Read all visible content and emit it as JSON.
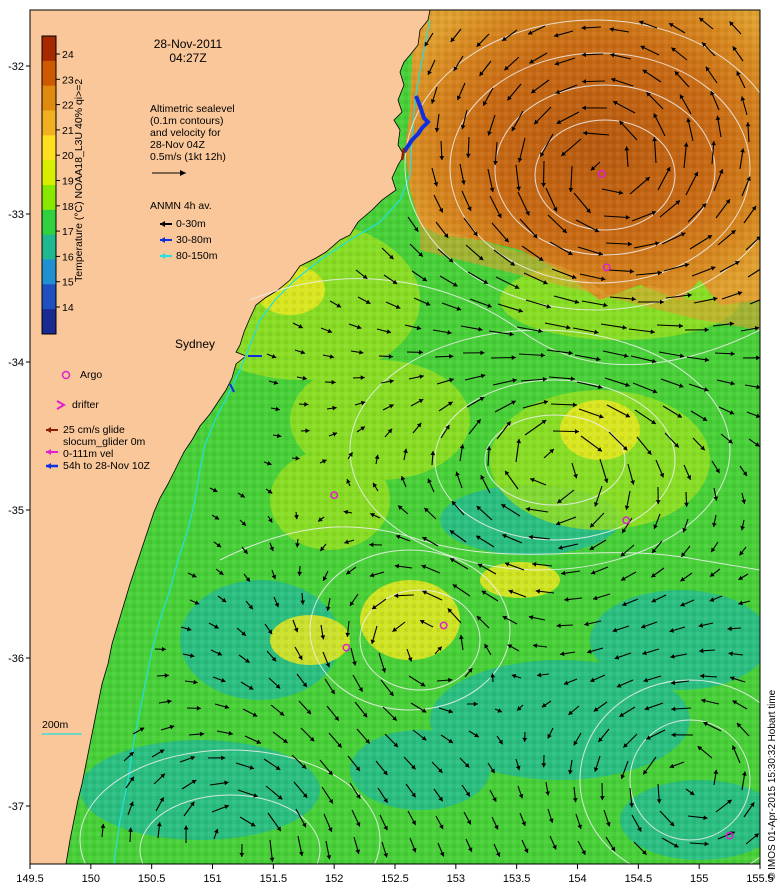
{
  "header": {
    "date": "28-Nov-2011",
    "time": "04:27Z"
  },
  "colorbar": {
    "label": "Temperature (°C) NOAA18_L3U 40% qi>=2",
    "ticks": [
      "24",
      "23",
      "22",
      "21",
      "20",
      "19",
      "18",
      "17",
      "16",
      "15",
      "14"
    ],
    "colors": [
      "#a52a00",
      "#cd5a00",
      "#e08a10",
      "#f0b020",
      "#ffe020",
      "#d8f000",
      "#88e800",
      "#30d040",
      "#20b890",
      "#2090d0",
      "#2050c0",
      "#1a2a90"
    ]
  },
  "sealevel_note": {
    "lines": [
      "Altimetric sealevel",
      "(0.1m contours)",
      "and velocity for",
      "28-Nov 04Z",
      "0.5m/s (1kt 12h)"
    ]
  },
  "anmn": {
    "title": "ANMN 4h av.",
    "items": [
      {
        "label": "0-30m",
        "color": "#000000"
      },
      {
        "label": "30-80m",
        "color": "#1030e0"
      },
      {
        "label": "80-150m",
        "color": "#20e0e0"
      }
    ]
  },
  "legend": {
    "argo": "Argo",
    "drifter": "drifter",
    "glider_lines": [
      "25 cm/s glide",
      "slocum_glider 0m",
      "0-111m vel",
      "54h to 28-Nov 10Z"
    ]
  },
  "place": {
    "sydney": "Sydney"
  },
  "isobath_label": "200m",
  "y_axis": {
    "ticks": [
      "-32",
      "-33",
      "-34",
      "-35",
      "-36",
      "-37"
    ]
  },
  "x_axis": {
    "ticks": [
      "149.5",
      "150",
      "150.5",
      "151",
      "151.5",
      "152",
      "152.5",
      "153",
      "153.5",
      "154",
      "154.5",
      "155",
      "155.5"
    ]
  },
  "credit": "© IMOS 01-Apr-2015 15:30:32 Hobart time",
  "argo_floats": [
    {
      "lon": 154.2,
      "lat": -32.73
    },
    {
      "lon": 154.24,
      "lat": -33.36
    },
    {
      "lon": 152.0,
      "lat": -34.9
    },
    {
      "lon": 154.4,
      "lat": -35.07
    },
    {
      "lon": 152.9,
      "lat": -35.78
    },
    {
      "lon": 152.1,
      "lat": -35.93
    },
    {
      "lon": 155.25,
      "lat": -37.2
    }
  ],
  "sst_colors": {
    "land": "#f9c79a",
    "warm_core": "#c86a14",
    "warm_mid": "#e09a28",
    "shelf": "#98e020",
    "green": "#48d038",
    "teal": "#22b89a",
    "yellow": "#e8e820"
  }
}
